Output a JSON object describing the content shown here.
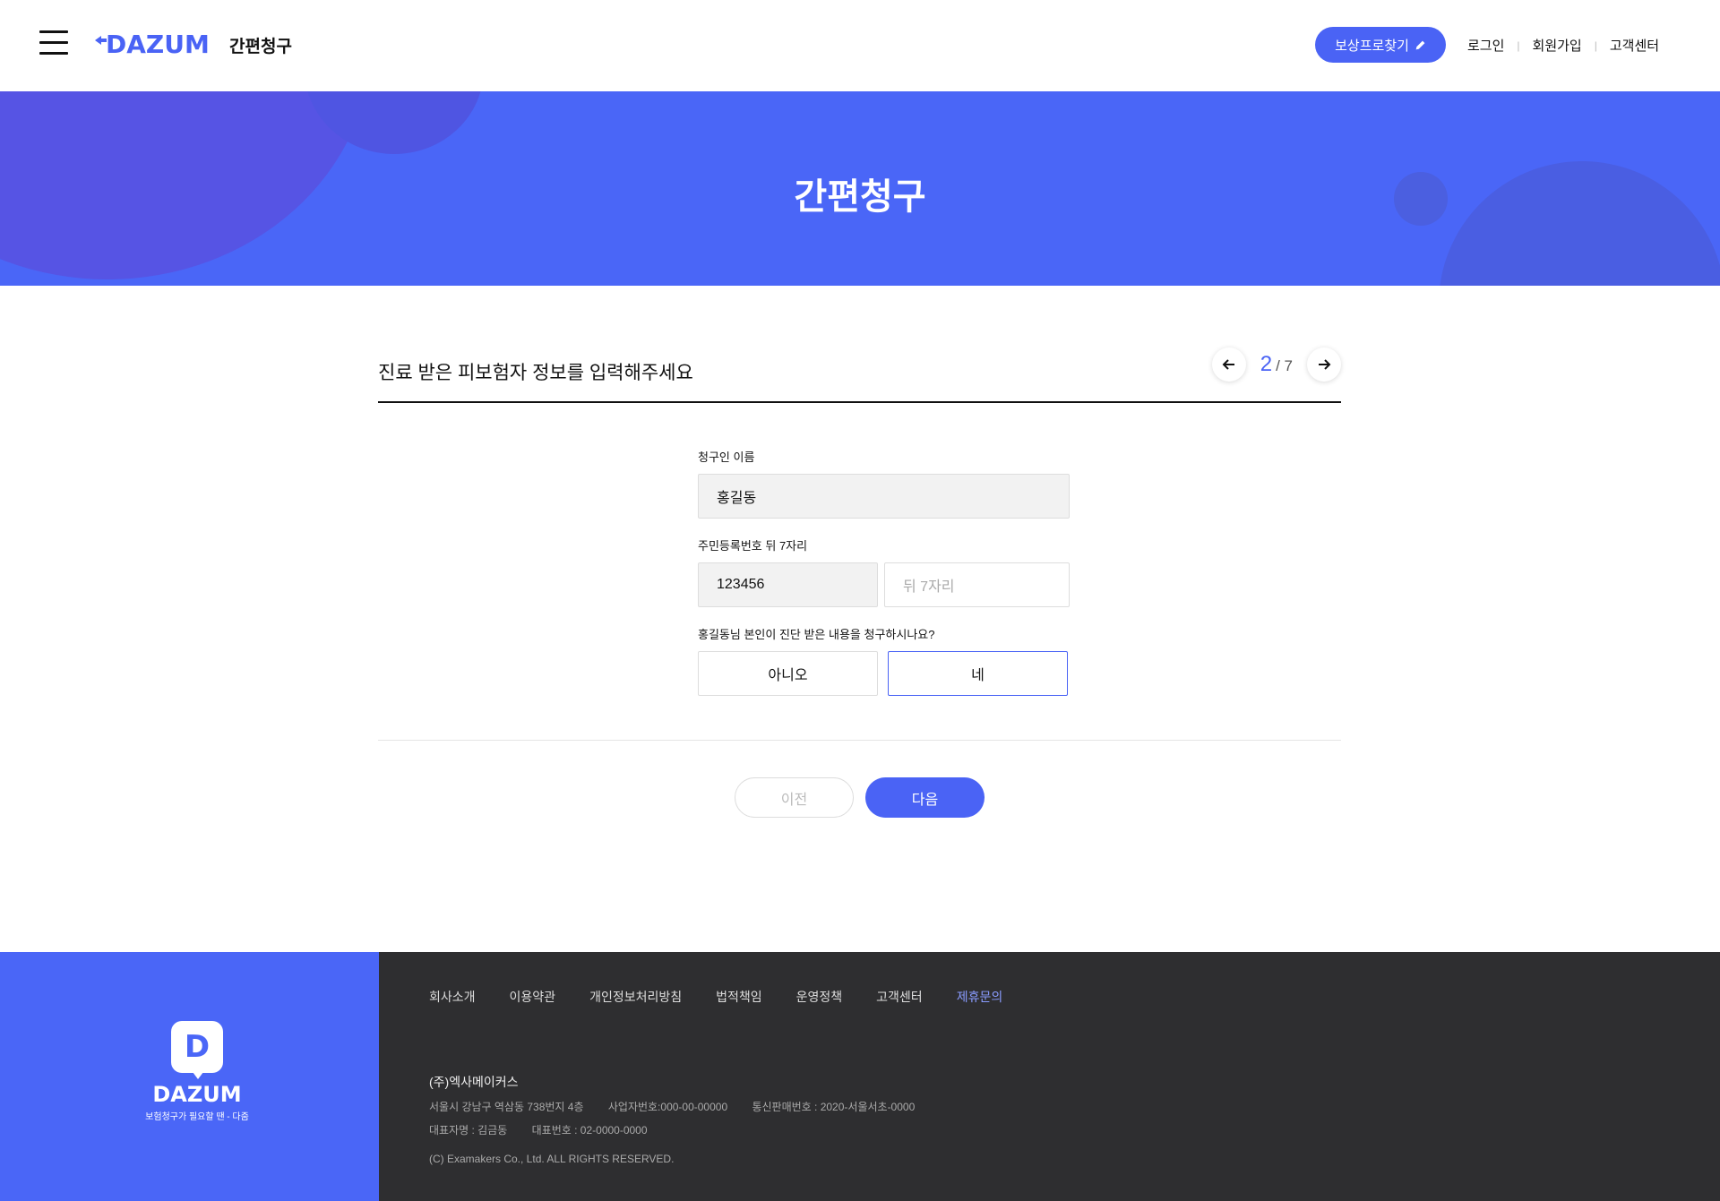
{
  "header": {
    "logo": "DAZUM",
    "title": "간편청구",
    "reward_button": "보상프로찾기",
    "links": [
      "로그인",
      "회원가입",
      "고객센터"
    ]
  },
  "hero": {
    "title": "간편청구"
  },
  "section": {
    "title": "진료 받은 피보험자 정보를 입력해주세요",
    "pager_current": "2",
    "pager_total": "/ 7"
  },
  "form": {
    "name_label": "청구인 이름",
    "name_value": "홍길동",
    "rrn_label": "주민등록번호 뒤 7자리",
    "rrn_front_value": "123456",
    "rrn_back_placeholder": "뒤 7자리",
    "question": "홍길동님 본인이 진단 받은 내용을 청구하시나요?",
    "option_no": "아니오",
    "option_yes": "네",
    "selected": "네"
  },
  "buttons": {
    "prev": "이전",
    "next": "다음"
  },
  "footer": {
    "logo": "DAZUM",
    "logo_sub": "보험청구가 필요할 땐 - 다줌",
    "nav": [
      "회사소개",
      "이용약관",
      "개인정보처리방침",
      "법적책임",
      "운영정책",
      "고객센터",
      "제휴문의"
    ],
    "company": "(주)엑사메이커스",
    "address": "서울시 강남구 역삼동 738번지 4층",
    "biz_no": "사업자번호:000-00-00000",
    "sales_no": "통신판매번호 : 2020-서울서초-0000",
    "ceo": "대표자명 : 김금동",
    "tel": "대표번호 : 02-0000-0000",
    "copyright": "(C) Examakers Co., Ltd. ALL RIGHTS RESERVED."
  },
  "colors": {
    "brand": "#4a63f5",
    "footer_dark": "#2e2e30"
  }
}
